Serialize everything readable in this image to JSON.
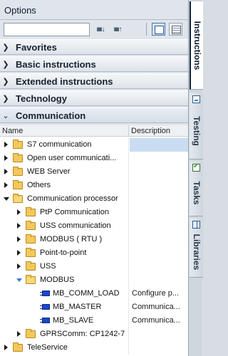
{
  "pane": {
    "title": "Options",
    "search": {
      "value": "",
      "placeholder": ""
    },
    "toolbar": {
      "search_down_label": "ıııı↓",
      "search_up_label": "ıııı↑"
    }
  },
  "sections": [
    {
      "label": "Favorites",
      "expanded": false
    },
    {
      "label": "Basic instructions",
      "expanded": false
    },
    {
      "label": "Extended instructions",
      "expanded": false
    },
    {
      "label": "Technology",
      "expanded": false
    },
    {
      "label": "Communication",
      "expanded": true
    }
  ],
  "tree": {
    "columns": {
      "name": "Name",
      "description": "Description"
    },
    "rows": [
      {
        "label": "S7 communication",
        "description": "",
        "icon": "folder-icon",
        "expander": "closed"
      },
      {
        "label": "Open user communicati...",
        "description": "",
        "icon": "folder-icon",
        "expander": "closed"
      },
      {
        "label": "WEB Server",
        "description": "",
        "icon": "folder-icon",
        "expander": "closed"
      },
      {
        "label": "Others",
        "description": "",
        "icon": "folder-icon",
        "expander": "closed"
      },
      {
        "label": "Communication processor",
        "description": "",
        "icon": "folder-open-icon",
        "expander": "open"
      },
      {
        "label": "PtP Communication",
        "description": "",
        "icon": "folder-icon",
        "expander": "closed"
      },
      {
        "label": "USS communication",
        "description": "",
        "icon": "folder-icon",
        "expander": "closed"
      },
      {
        "label": "MODBUS ( RTU )",
        "description": "",
        "icon": "folder-icon",
        "expander": "closed"
      },
      {
        "label": "Point-to-point",
        "description": "",
        "icon": "folder-icon",
        "expander": "closed"
      },
      {
        "label": "USS",
        "description": "",
        "icon": "folder-icon",
        "expander": "closed"
      },
      {
        "label": "MODBUS",
        "description": "",
        "icon": "folder-open-icon",
        "expander": "open"
      },
      {
        "label": "MB_COMM_LOAD",
        "description": "Configure p...",
        "icon": "function-block-icon",
        "expander": "none"
      },
      {
        "label": "MB_MASTER",
        "description": "Communica...",
        "icon": "function-block-icon",
        "expander": "none"
      },
      {
        "label": "MB_SLAVE",
        "description": "Communica...",
        "icon": "function-block-icon",
        "expander": "none"
      },
      {
        "label": "GPRSComm: CP1242-7",
        "description": "",
        "icon": "folder-icon",
        "expander": "closed"
      },
      {
        "label": "TeleService",
        "description": "",
        "icon": "folder-icon",
        "expander": "closed"
      }
    ]
  },
  "side_tabs": [
    {
      "label": "Instructions",
      "active": true,
      "icon": ""
    },
    {
      "label": "Testing",
      "active": false,
      "icon": "testing-icon"
    },
    {
      "label": "Tasks",
      "active": false,
      "icon": "tasks-icon"
    },
    {
      "label": "Libraries",
      "active": false,
      "icon": "libraries-icon"
    }
  ],
  "colors": {
    "pane_background": "#dfe5eb",
    "selected_highlight": "#c9dcf1",
    "folder": "#f3c85a",
    "function_block": "#1f46c9",
    "modbus_expander": "#3a7fd0"
  }
}
